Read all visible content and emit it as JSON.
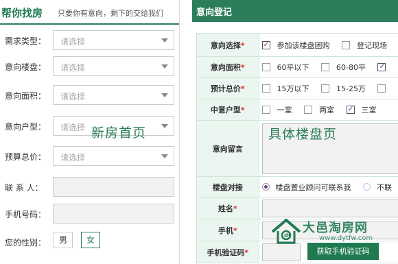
{
  "left": {
    "title": "帮你找房",
    "subtitle": "只要你有意向，剩下的交给我们",
    "placeholder": "请选择",
    "fields": [
      {
        "label": "需求类型："
      },
      {
        "label": "意向楼盘："
      },
      {
        "label": "意向面积："
      },
      {
        "label": "意向户型："
      },
      {
        "label": "预算总价："
      }
    ],
    "contact_label": "联 系 人：",
    "phone_label": "手机号码：",
    "gender_label": "您的性别：",
    "gender_options": [
      "男",
      "女"
    ],
    "gender_selected": "女",
    "caption": "新房首页"
  },
  "right": {
    "title": "意向登记",
    "caption": "具体楼盘页",
    "rows": {
      "intent": {
        "label": "意向选择",
        "options": [
          "参加该楼盘团购",
          "登记现场"
        ]
      },
      "area": {
        "label": "意向面积",
        "options": [
          "60平以下",
          "60-80平"
        ]
      },
      "price": {
        "label": "预计总价",
        "options": [
          "15万以下",
          "15-25万"
        ]
      },
      "layout": {
        "label": "中意户型",
        "options": [
          "一室",
          "两室",
          "三室"
        ],
        "checked": "三室"
      },
      "message": {
        "label": "意向留言"
      },
      "contact": {
        "label": "楼盘对接",
        "options": [
          "楼盘置业顾问可联系我",
          "不联"
        ],
        "selected": "楼盘置业顾问可联系我"
      },
      "name": {
        "label": "姓名"
      },
      "mobile": {
        "label": "手机"
      },
      "verify": {
        "label": "手机验证码",
        "button": "获取手机验证码"
      }
    },
    "required_mark": "*"
  },
  "logo": {
    "name": "大邑淘房网",
    "url": "www.dytfw.com"
  },
  "colors": {
    "accent": "#2c7d5a",
    "required": "#e0262b",
    "check": "#7a3a98"
  }
}
